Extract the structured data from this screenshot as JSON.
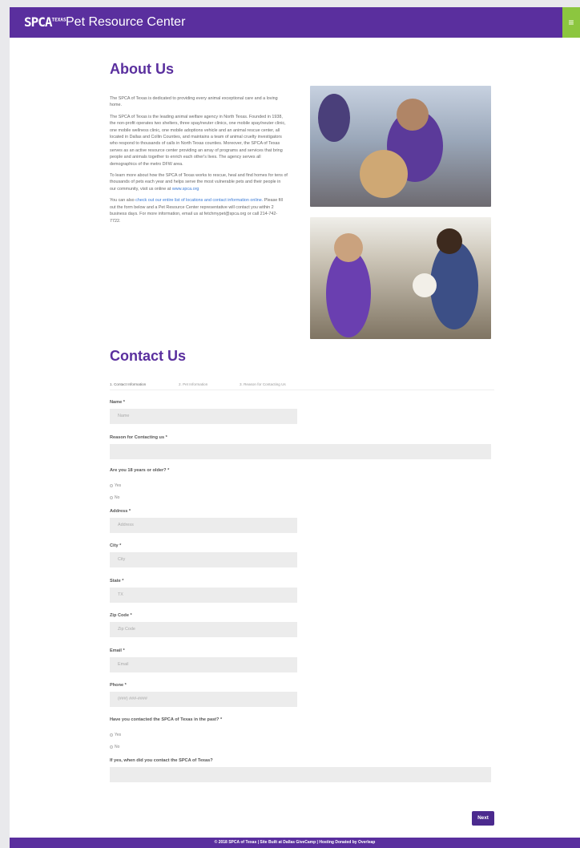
{
  "header": {
    "logo": "SPCA",
    "logo_tm": "TEXAS",
    "title": "Pet Resource Center",
    "menu_icon": "≡"
  },
  "about": {
    "title": "About Us",
    "p1": "The SPCA of Texas is dedicated to providing every animal exceptional care and a loving home.",
    "p2": "The SPCA of Texas is the leading animal welfare agency in North Texas. Founded in 1938, the non-profit operates two shelters, three spay/neuter clinics, one mobile spay/neuter clinic, one mobile wellness clinic, one mobile adoptions vehicle and an animal rescue center, all located in Dallas and Collin Counties, and maintains a team of animal cruelty investigators who respond to thousands of calls in North Texas counties. Moreover, the SPCA of Texas serves as an active resource center providing an array of programs and services that bring people and animals together to enrich each other's lives. The agency serves all demographics of the metro DFW area.",
    "p3": "To learn more about how the SPCA of Texas works to rescue, heal and find homes for tens of thousands of pets each year and helps serve the most vulnerable pets and their people in our community, visit us online at",
    "p3_link": "www.spca.org",
    "p4_lead": "You can also",
    "p4_link": "check out our entire list of locations and contact information online.",
    "p4_rest": "Please fill out the form below and a Pet Resource Center representative will contact you within 2 business days. For more information, email us at fetchmypet@spca.org or call 214-742-7722."
  },
  "contact": {
    "title": "Contact Us",
    "steps": [
      "1. Contact Information",
      "2. Pet Information",
      "3. Reason for Contacting Us"
    ],
    "name_label": "Name *",
    "name_ph": "Name",
    "reason_label": "Reason for Contacting us *",
    "age_label": "Are you 18 years or older? *",
    "yes": "Yes",
    "no": "No",
    "address_label": "Address *",
    "address_ph": "Address",
    "city_label": "City *",
    "city_ph": "City",
    "state_label": "State *",
    "state_ph": "TX",
    "zip_label": "Zip Code *",
    "zip_ph": "Zip Code",
    "email_label": "Email *",
    "email_ph": "Email",
    "phone_label": "Phone *",
    "phone_ph": "(###) ###-####",
    "past_label": "Have you contacted the SPCA of Texas in the past? *",
    "when_label": "If yes, when did you contact the SPCA of Texas?",
    "next": "Next"
  },
  "footer": {
    "text": "© 2018 SPCA of Texas | Site Built at Dallas GiveCamp | Hosting Donated by Overleap"
  },
  "colors": {
    "brand": "#5a2f9e",
    "accent": "#8cc63f"
  }
}
